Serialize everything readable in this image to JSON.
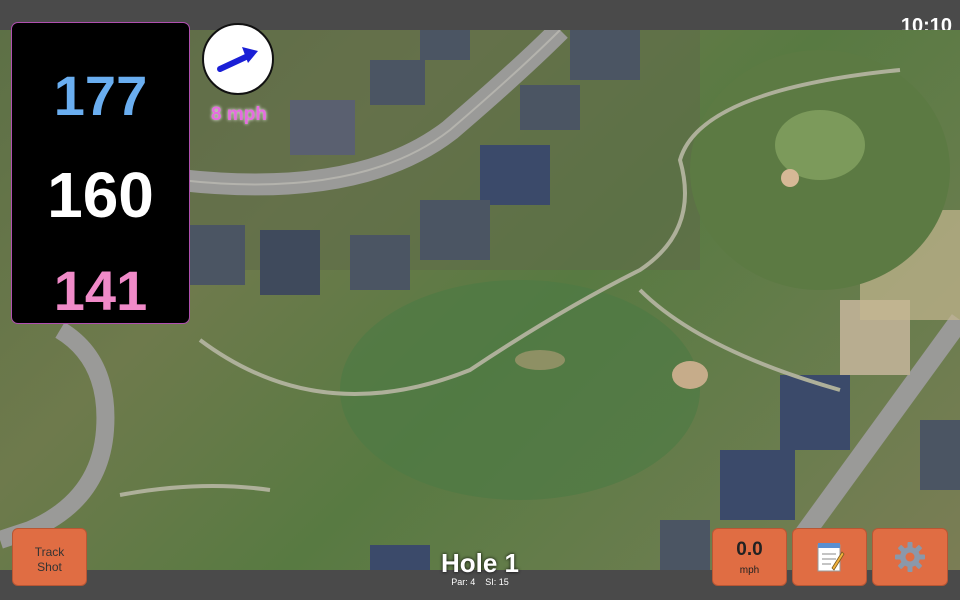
{
  "status": {
    "time": "10:10"
  },
  "distances": {
    "back": "177",
    "middle": "160",
    "front": "141"
  },
  "wind": {
    "speed_label": "8 mph",
    "arrow_icon": "wind-direction-arrow-icon"
  },
  "buttons": {
    "track_shot_line1": "Track",
    "track_shot_line2": "Shot",
    "speed_value": "0.0",
    "speed_unit": "mph",
    "note_icon": "notepad-icon",
    "settings_icon": "gear-icon"
  },
  "hole": {
    "title": "Hole 1",
    "par_label": "Par: 4",
    "si_label": "SI: 15"
  },
  "colors": {
    "back": "#6aaef0",
    "middle": "#ffffff",
    "front": "#f08ac8",
    "button": "#e06d43",
    "wind_text": "#e66ce0"
  }
}
